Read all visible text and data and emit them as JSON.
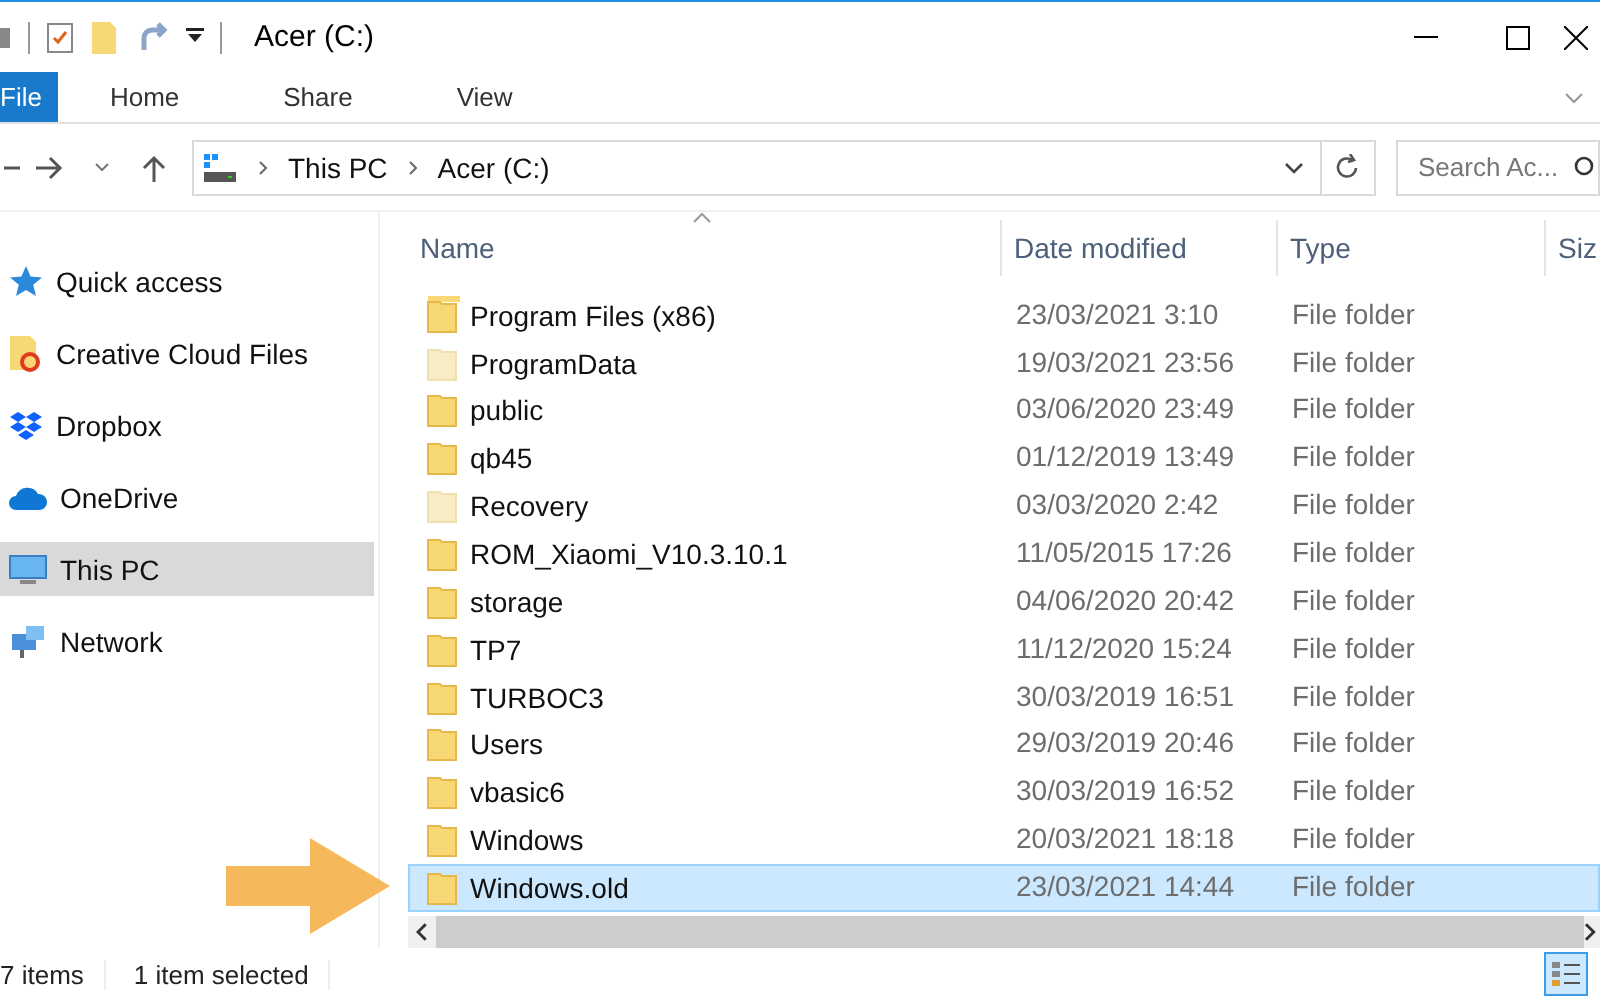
{
  "window": {
    "title": "Acer (C:)"
  },
  "ribbon_tabs": [
    {
      "label": "File",
      "kind": "file"
    },
    {
      "label": "Home",
      "kind": "tab"
    },
    {
      "label": "Share",
      "kind": "tab"
    },
    {
      "label": "View",
      "kind": "tab"
    }
  ],
  "address": {
    "crumbs": [
      "This PC",
      "Acer (C:)"
    ]
  },
  "search": {
    "placeholder": "Search Ac..."
  },
  "sidebar": {
    "items": [
      {
        "label": "Quick access",
        "kind": "star",
        "selected": false
      },
      {
        "label": "Creative Cloud Files",
        "kind": "cloudfiles",
        "selected": false
      },
      {
        "label": "Dropbox",
        "kind": "dropbox",
        "selected": false
      },
      {
        "label": "OneDrive",
        "kind": "onedrive",
        "selected": false
      },
      {
        "label": "This PC",
        "kind": "pc",
        "selected": true
      },
      {
        "label": "Network",
        "kind": "network",
        "selected": false
      }
    ]
  },
  "table": {
    "columns": [
      "Name",
      "Date modified",
      "Type",
      "Siz"
    ],
    "rows": [
      {
        "name": "Program Files (x86)",
        "date": "23/03/2021 3:10",
        "type": "File folder",
        "hidden": false,
        "selected": false
      },
      {
        "name": "ProgramData",
        "date": "19/03/2021 23:56",
        "type": "File folder",
        "hidden": true,
        "selected": false
      },
      {
        "name": "public",
        "date": "03/06/2020 23:49",
        "type": "File folder",
        "hidden": false,
        "selected": false
      },
      {
        "name": "qb45",
        "date": "01/12/2019 13:49",
        "type": "File folder",
        "hidden": false,
        "selected": false
      },
      {
        "name": "Recovery",
        "date": "03/03/2020 2:42",
        "type": "File folder",
        "hidden": true,
        "selected": false
      },
      {
        "name": "ROM_Xiaomi_V10.3.10.1",
        "date": "11/05/2015 17:26",
        "type": "File folder",
        "hidden": false,
        "selected": false
      },
      {
        "name": "storage",
        "date": "04/06/2020 20:42",
        "type": "File folder",
        "hidden": false,
        "selected": false
      },
      {
        "name": "TP7",
        "date": "11/12/2020 15:24",
        "type": "File folder",
        "hidden": false,
        "selected": false
      },
      {
        "name": "TURBOC3",
        "date": "30/03/2019 16:51",
        "type": "File folder",
        "hidden": false,
        "selected": false
      },
      {
        "name": "Users",
        "date": "29/03/2019 20:46",
        "type": "File folder",
        "hidden": false,
        "selected": false
      },
      {
        "name": "vbasic6",
        "date": "30/03/2019 16:52",
        "type": "File folder",
        "hidden": false,
        "selected": false
      },
      {
        "name": "Windows",
        "date": "20/03/2021 18:18",
        "type": "File folder",
        "hidden": false,
        "selected": false
      },
      {
        "name": "Windows.old",
        "date": "23/03/2021 14:44",
        "type": "File folder",
        "hidden": false,
        "selected": true
      }
    ]
  },
  "status_bar": {
    "count": "7 items",
    "selection": "1 item selected"
  }
}
